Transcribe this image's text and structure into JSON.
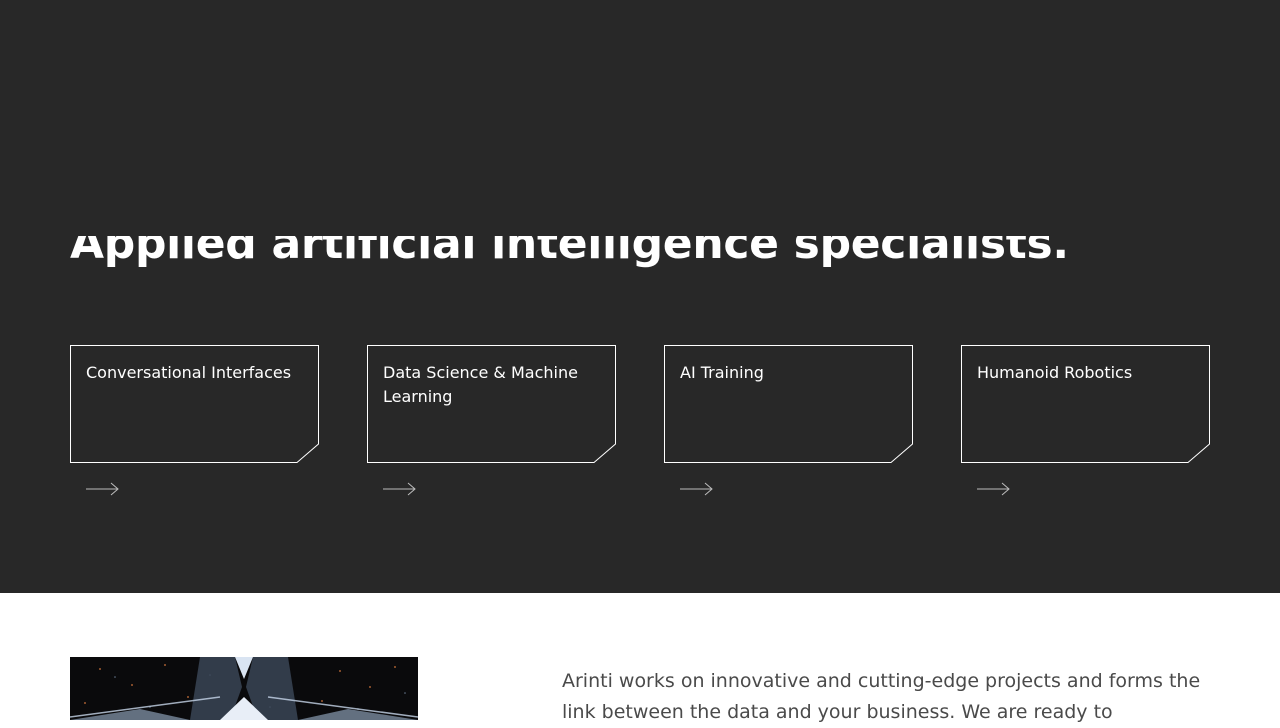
{
  "hero": {
    "title": "Applied artificial intelligence specialists."
  },
  "services": [
    {
      "label": "Conversational Interfaces",
      "arrow_icon": "arrow-right-icon"
    },
    {
      "label": "Data Science & Machine Learning",
      "arrow_icon": "arrow-right-icon"
    },
    {
      "label": "AI Training",
      "arrow_icon": "arrow-right-icon"
    },
    {
      "label": "Humanoid Robotics",
      "arrow_icon": "arrow-right-icon"
    }
  ],
  "intro": {
    "text": "Arinti works on innovative and cutting-edge projects and forms the link between the data and your business. We are ready to"
  },
  "colors": {
    "hero_background": "#282828",
    "card_border": "#ffffff",
    "body_text": "#4a4a4a"
  }
}
